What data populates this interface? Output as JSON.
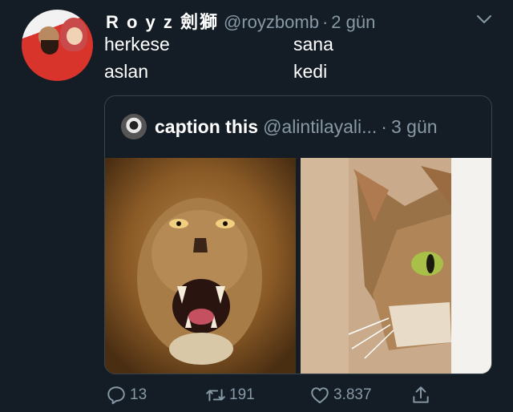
{
  "author": {
    "display_name": "R o y z 劍獅",
    "handle": "@royzbomb",
    "separator": "·",
    "time": "2 gün"
  },
  "body": {
    "col1_line1": "herkese",
    "col2_line1": "sana",
    "col1_line2": "aslan",
    "col2_line2": "kedi"
  },
  "quoted": {
    "display_name": "caption this",
    "handle": "@alintilayali...",
    "separator": "·",
    "time": "3 gün"
  },
  "actions": {
    "reply_count": "13",
    "retweet_count": "191",
    "like_count": "3.837"
  },
  "icons": {
    "menu": "chevron-down-icon",
    "reply": "reply-icon",
    "retweet": "retweet-icon",
    "like": "heart-icon",
    "share": "share-icon"
  },
  "colors": {
    "background": "#141d26",
    "secondary_text": "#8899a6",
    "border": "#38444d"
  }
}
